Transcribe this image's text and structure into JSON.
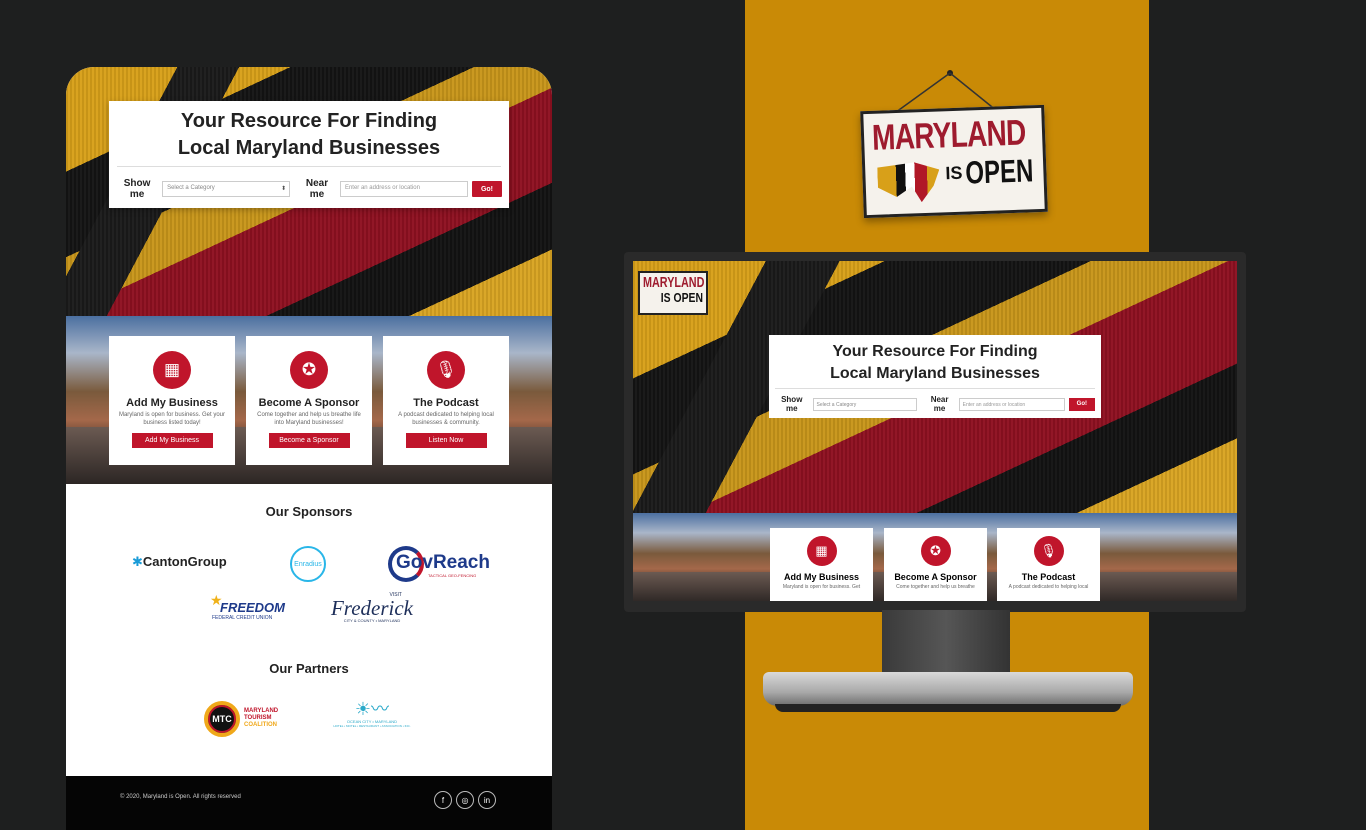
{
  "site": {
    "hero": {
      "title_line1": "Your Resource For Finding",
      "title_line2": "Local Maryland Businesses",
      "show_label": "Show me",
      "category_placeholder": "Select a Category",
      "near_label": "Near me",
      "address_placeholder": "Enter an address or location",
      "go_label": "Go!"
    },
    "cards": [
      {
        "icon": "building-icon",
        "title": "Add My Business",
        "text": "Maryland is open for business. Get your business listed today!",
        "button": "Add My Business"
      },
      {
        "icon": "award-ribbon-icon",
        "title": "Become A Sponsor",
        "text": "Come together and help us breathe life into Maryland businesses!",
        "button": "Become a Sponsor"
      },
      {
        "icon": "microphone-icon",
        "title": "The Podcast",
        "text": "A podcast dedicated to helping local businesses & community.",
        "button": "Listen Now"
      }
    ],
    "monitor_cards_text": [
      "Maryland is open for business. Get",
      "Come together and help us breathe",
      "A podcast dedicated to helping local"
    ],
    "sponsors_title": "Our Sponsors",
    "sponsors": {
      "canton": "CantonGroup",
      "enradius": "Enradius",
      "govreach": "GovReach",
      "govreach_tag": "TACTICAL GEO-FENCING",
      "freedom": "FREEDOM",
      "freedom_sub": "FEDERAL CREDIT UNION",
      "frederick_visit": "VISIT",
      "frederick": "Frederick",
      "frederick_sub": "CITY & COUNTY • MARYLAND"
    },
    "partners_title": "Our Partners",
    "partners": {
      "mtc_badge": "MTC",
      "mtc_line1": "MARYLAND",
      "mtc_line2": "TOURISM",
      "mtc_line3": "COALITION",
      "ocean": "OCEAN CITY • MARYLAND",
      "ocean_sub": "HOTEL • MOTEL • RESTAURANT • ASSOCIATION • INC."
    },
    "footer": {
      "copyright": "© 2020, Maryland is Open. All rights reserved",
      "social": [
        "f",
        "◎",
        "in"
      ]
    }
  },
  "brand": {
    "line1": "MARYLAND",
    "line2": "IS",
    "line3": "OPEN"
  },
  "colors": {
    "accent_red": "#c0152b",
    "gold_band": "#c98a06",
    "background": "#1e1f1f"
  }
}
